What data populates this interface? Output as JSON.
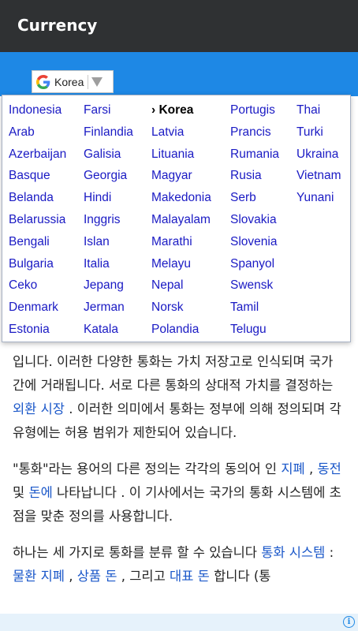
{
  "appbar": {
    "title": "Currency"
  },
  "translate_widget": {
    "selected_language": "Korea",
    "icon": "google-g-icon"
  },
  "language_menu": {
    "columns": [
      [
        "Indonesia",
        "Arab",
        "Azerbaijan",
        "Basque",
        "Belanda",
        "Belarussia",
        "Bengali",
        "Bulgaria",
        "Ceko",
        "Denmark",
        "Estonia"
      ],
      [
        "Farsi",
        "Finlandia",
        "Galisia",
        "Georgia",
        "Hindi",
        "Inggris",
        "Islan",
        "Italia",
        "Jepang",
        "Jerman",
        "Katala"
      ],
      [
        "› Korea",
        "Latvia",
        "Lituania",
        "Magyar",
        "Makedonia",
        "Malayalam",
        "Marathi",
        "Melayu",
        "Nepal",
        "Norsk",
        "Polandia"
      ],
      [
        "Portugis",
        "Prancis",
        "Rumania",
        "Rusia",
        "Serb",
        "Slovakia",
        "Slovenia",
        "Spanyol",
        "Swensk",
        "Tamil",
        "Telugu"
      ],
      [
        "Thai",
        "Turki",
        "Ukraina",
        "Vietnam",
        "Yunani"
      ]
    ],
    "selected": "› Korea"
  },
  "article": {
    "p1": {
      "t1": "입니다. 이러한 다양한 통화는 가치 저장고로 인식되며 국가간에 거래됩니다. 서로 다른 통화의 상대적 가치를 결정하는 ",
      "link1": "외환 시장",
      "t2": " .  이러한 의미에서 통화는 정부에 의해 정의되며 각 유형에는 허용 범위가 제한되어 있습니다."
    },
    "p2": {
      "t1": "\"통화\"라는 용어의 다른 정의는 각각의 동의어 인 ",
      "link1": "지폐",
      "t2": " ,  ",
      "link2": "동전",
      "t3": " 및  ",
      "link3": "돈에",
      "t4": " 나타납니다  . 이 기사에서는 국가의 통화 시스템에 초점을 맞춘 정의를 사용합니다."
    },
    "p3": {
      "t1": "하나는 세 가지로 통화를 분류 할 수 있습니다  ",
      "link1": "통화 시스템",
      "t2": " :  ",
      "link2": "물환 지폐",
      "t3": " ,  ",
      "link3": "상품 돈",
      "t4": " , 그리고  ",
      "link4": "대표 돈",
      "t5": " 합니다 (통"
    }
  },
  "ad_bar": {
    "icon": "info-icon"
  },
  "colors": {
    "appbar": "#2f3133",
    "band": "#1e88e5",
    "menu_link": "#1a1ac4",
    "article_link": "#1a57c9"
  }
}
